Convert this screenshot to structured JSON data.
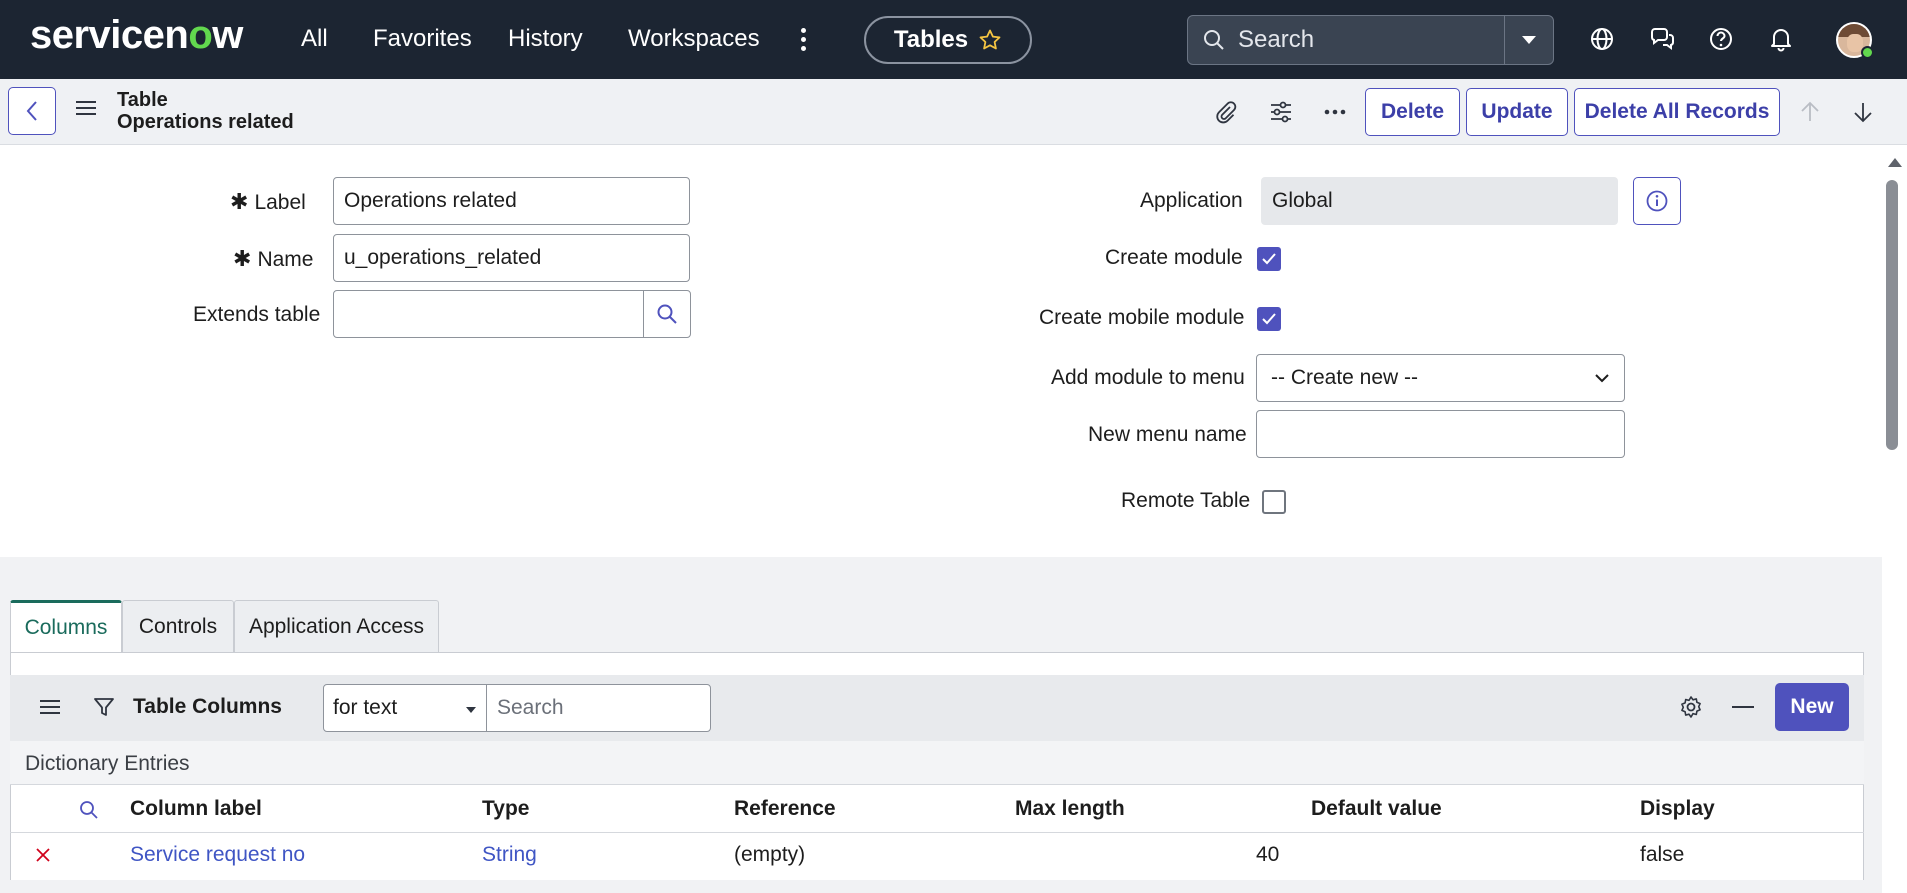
{
  "topnav": {
    "logo_text_pre": "servicen",
    "logo_text_o": "o",
    "logo_text_post": "w",
    "links": [
      "All",
      "Favorites",
      "History",
      "Workspaces"
    ],
    "current_page_pill": "Tables",
    "search_placeholder": "Search",
    "icons": [
      "globe-icon",
      "chat-icon",
      "help-icon",
      "bell-icon"
    ]
  },
  "header": {
    "record_type": "Table",
    "record_name": "Operations related",
    "buttons": {
      "delete": "Delete",
      "update": "Update",
      "delete_all": "Delete All Records"
    }
  },
  "form": {
    "label": {
      "label": "Label",
      "value": "Operations related",
      "required": "✱"
    },
    "name": {
      "label": "Name",
      "value": "u_operations_related",
      "required": "✱"
    },
    "extends": {
      "label": "Extends table",
      "value": ""
    },
    "application": {
      "label": "Application",
      "value": "Global"
    },
    "create_module": {
      "label": "Create module",
      "checked": true
    },
    "create_mobile_module": {
      "label": "Create mobile module",
      "checked": true
    },
    "add_module_to_menu": {
      "label": "Add module to menu",
      "selected": "-- Create new --"
    },
    "new_menu_name": {
      "label": "New menu name",
      "value": ""
    },
    "remote_table": {
      "label": "Remote Table",
      "checked": false
    }
  },
  "tabs": [
    {
      "label": "Columns",
      "active": true
    },
    {
      "label": "Controls",
      "active": false
    },
    {
      "label": "Application Access",
      "active": false
    }
  ],
  "list": {
    "title": "Table Columns",
    "filter_select": "for text",
    "search_placeholder": "Search",
    "new_label": "New",
    "section_label": "Dictionary Entries",
    "columns": [
      "Column label",
      "Type",
      "Reference",
      "Max length",
      "Default value",
      "Display"
    ],
    "rows": [
      {
        "column_label": "Service request no",
        "type": "String",
        "reference": "(empty)",
        "max_length": "40",
        "default_value": "",
        "display": "false"
      }
    ]
  },
  "colors": {
    "nav_bg": "#1c2532",
    "accent": "#4f52bd",
    "link": "#3f55c4",
    "tab_active": "#1a6b5c",
    "logo_green": "#62d84e",
    "delete_x": "#d0021b"
  }
}
